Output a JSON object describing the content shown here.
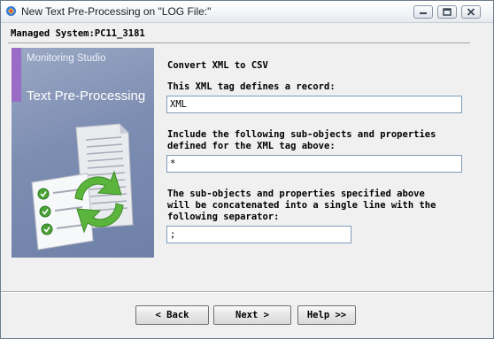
{
  "window": {
    "title": "New Text Pre-Processing on \"LOG File:\""
  },
  "header": {
    "managed_system": "Managed System:PC11_3181"
  },
  "banner": {
    "subtitle": "Monitoring Studio",
    "title": "Text Pre-Processing"
  },
  "form": {
    "heading": "Convert XML to CSV",
    "record_tag_label": "This XML tag defines a record:",
    "record_tag_value": "XML",
    "subobjects_label": "Include the following sub-objects and properties\ndefined for the XML tag above:",
    "subobjects_value": "*",
    "separator_label": "The sub-objects and properties specified above\nwill be concatenated into a single line with the\nfollowing separator:",
    "separator_value": ";"
  },
  "buttons": {
    "back": "< Back",
    "next": "Next >",
    "help": "Help >>"
  },
  "colors": {
    "banner_bg": "#7d8db2",
    "banner_accent": "#9a6cc7",
    "input_border": "#7f9db9"
  }
}
